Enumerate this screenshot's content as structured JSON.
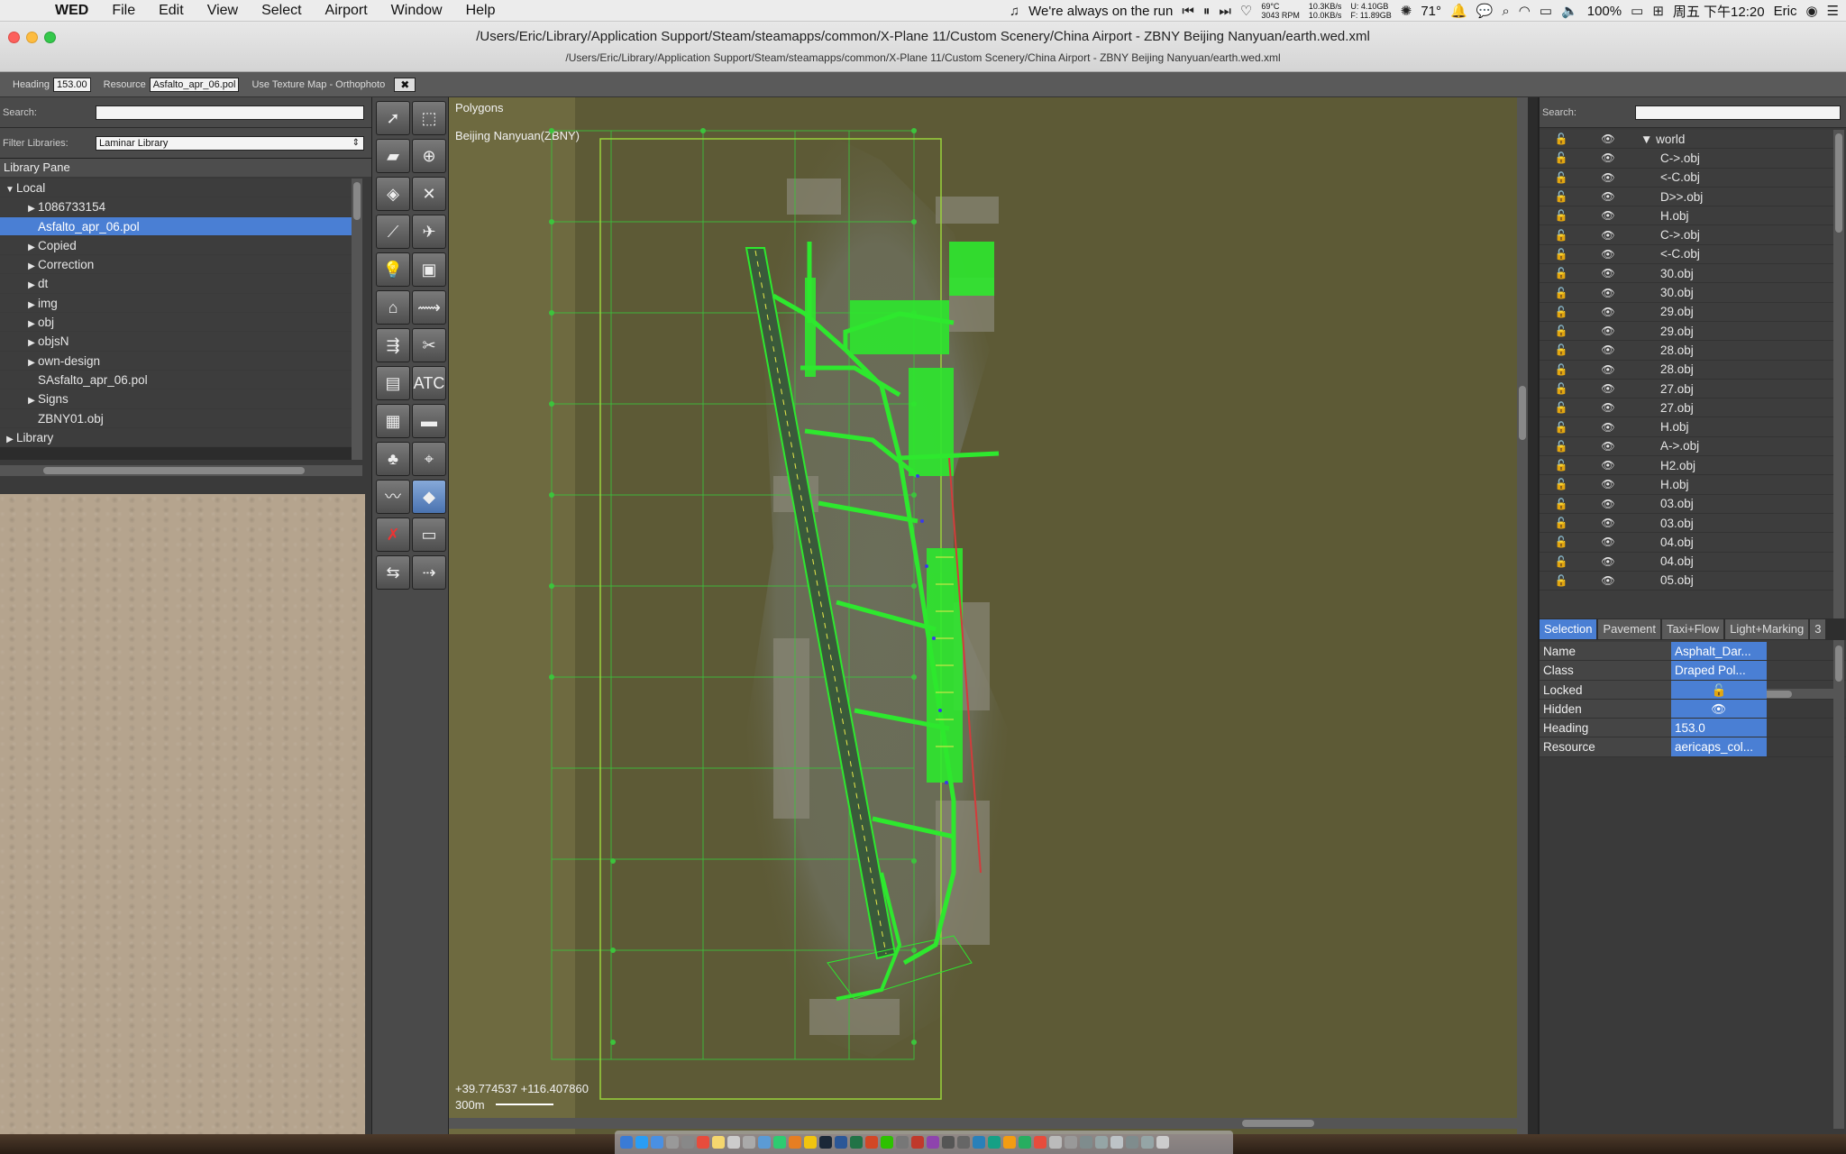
{
  "menubar": {
    "app": "WED",
    "items": [
      "File",
      "Edit",
      "View",
      "Select",
      "Airport",
      "Window",
      "Help"
    ],
    "now_playing": "We're always on the run",
    "temp_top": "69°C",
    "rpm": "3043 RPM",
    "net_up": "10.3KB/s",
    "net_down": "10.0KB/s",
    "mem_u": "U: 4.10GB",
    "mem_f": "F: 11.89GB",
    "weather": "71°",
    "battery": "100%",
    "datetime": "周五 下午12:20",
    "user": "Eric"
  },
  "window": {
    "title": "/Users/Eric/Library/Application Support/Steam/steamapps/common/X-Plane 11/Custom Scenery/China Airport - ZBNY Beijing Nanyuan/earth.wed.xml",
    "subtitle": "/Users/Eric/Library/Application Support/Steam/steamapps/common/X-Plane 11/Custom Scenery/China Airport - ZBNY Beijing Nanyuan/earth.wed.xml"
  },
  "toolbar": {
    "heading_label": "Heading",
    "heading_value": "153.00",
    "resource_label": "Resource",
    "resource_value": "Asfalto_apr_06.pol",
    "texture_label": "Use Texture Map - Orthophoto",
    "close_glyph": "✖"
  },
  "library": {
    "search_label": "Search:",
    "search_value": "",
    "filter_label": "Filter Libraries:",
    "filter_value": "Laminar Library",
    "pane_title": "Library Pane",
    "tree": [
      {
        "label": "Local",
        "arrow": "▼",
        "indent": 0
      },
      {
        "label": "1086733154",
        "arrow": "▶",
        "indent": 1
      },
      {
        "label": "Asfalto_apr_06.pol",
        "arrow": "",
        "indent": 1,
        "selected": true
      },
      {
        "label": "Copied",
        "arrow": "▶",
        "indent": 1
      },
      {
        "label": "Correction",
        "arrow": "▶",
        "indent": 1
      },
      {
        "label": "dt",
        "arrow": "▶",
        "indent": 1
      },
      {
        "label": "img",
        "arrow": "▶",
        "indent": 1
      },
      {
        "label": "obj",
        "arrow": "▶",
        "indent": 1
      },
      {
        "label": "objsN",
        "arrow": "▶",
        "indent": 1
      },
      {
        "label": "own-design",
        "arrow": "▶",
        "indent": 1
      },
      {
        "label": "SAsfalto_apr_06.pol",
        "arrow": "",
        "indent": 1
      },
      {
        "label": "Signs",
        "arrow": "▶",
        "indent": 1
      },
      {
        "label": "ZBNY01.obj",
        "arrow": "",
        "indent": 1
      },
      {
        "label": "Library",
        "arrow": "▶",
        "indent": 0
      }
    ]
  },
  "map": {
    "layer_label": "Polygons",
    "airport_label": "Beijing Nanyuan(ZBNY)",
    "coords": "+39.774537 +116.407860",
    "scale": "300m"
  },
  "objects": {
    "search_label": "Search:",
    "root": "world",
    "items": [
      "C->.obj",
      "<-C.obj",
      "D>>.obj",
      "H.obj",
      "C->.obj",
      "<-C.obj",
      "30.obj",
      "30.obj",
      "29.obj",
      "29.obj",
      "28.obj",
      "28.obj",
      "27.obj",
      "27.obj",
      "H.obj",
      "A->.obj",
      "H2.obj",
      "H.obj",
      "03.obj",
      "03.obj",
      "04.obj",
      "04.obj",
      "05.obj"
    ]
  },
  "props": {
    "tabs": [
      "Selection",
      "Pavement",
      "Taxi+Flow",
      "Light+Marking",
      "3"
    ],
    "rows": [
      {
        "key": "Name",
        "value": "Asphalt_Dar..."
      },
      {
        "key": "Class",
        "value": "Draped Pol..."
      },
      {
        "key": "Locked",
        "value": "🔓"
      },
      {
        "key": "Hidden",
        "value": "👁"
      },
      {
        "key": "Heading",
        "value": "153.0"
      },
      {
        "key": "Resource",
        "value": "aericaps_col..."
      }
    ]
  }
}
